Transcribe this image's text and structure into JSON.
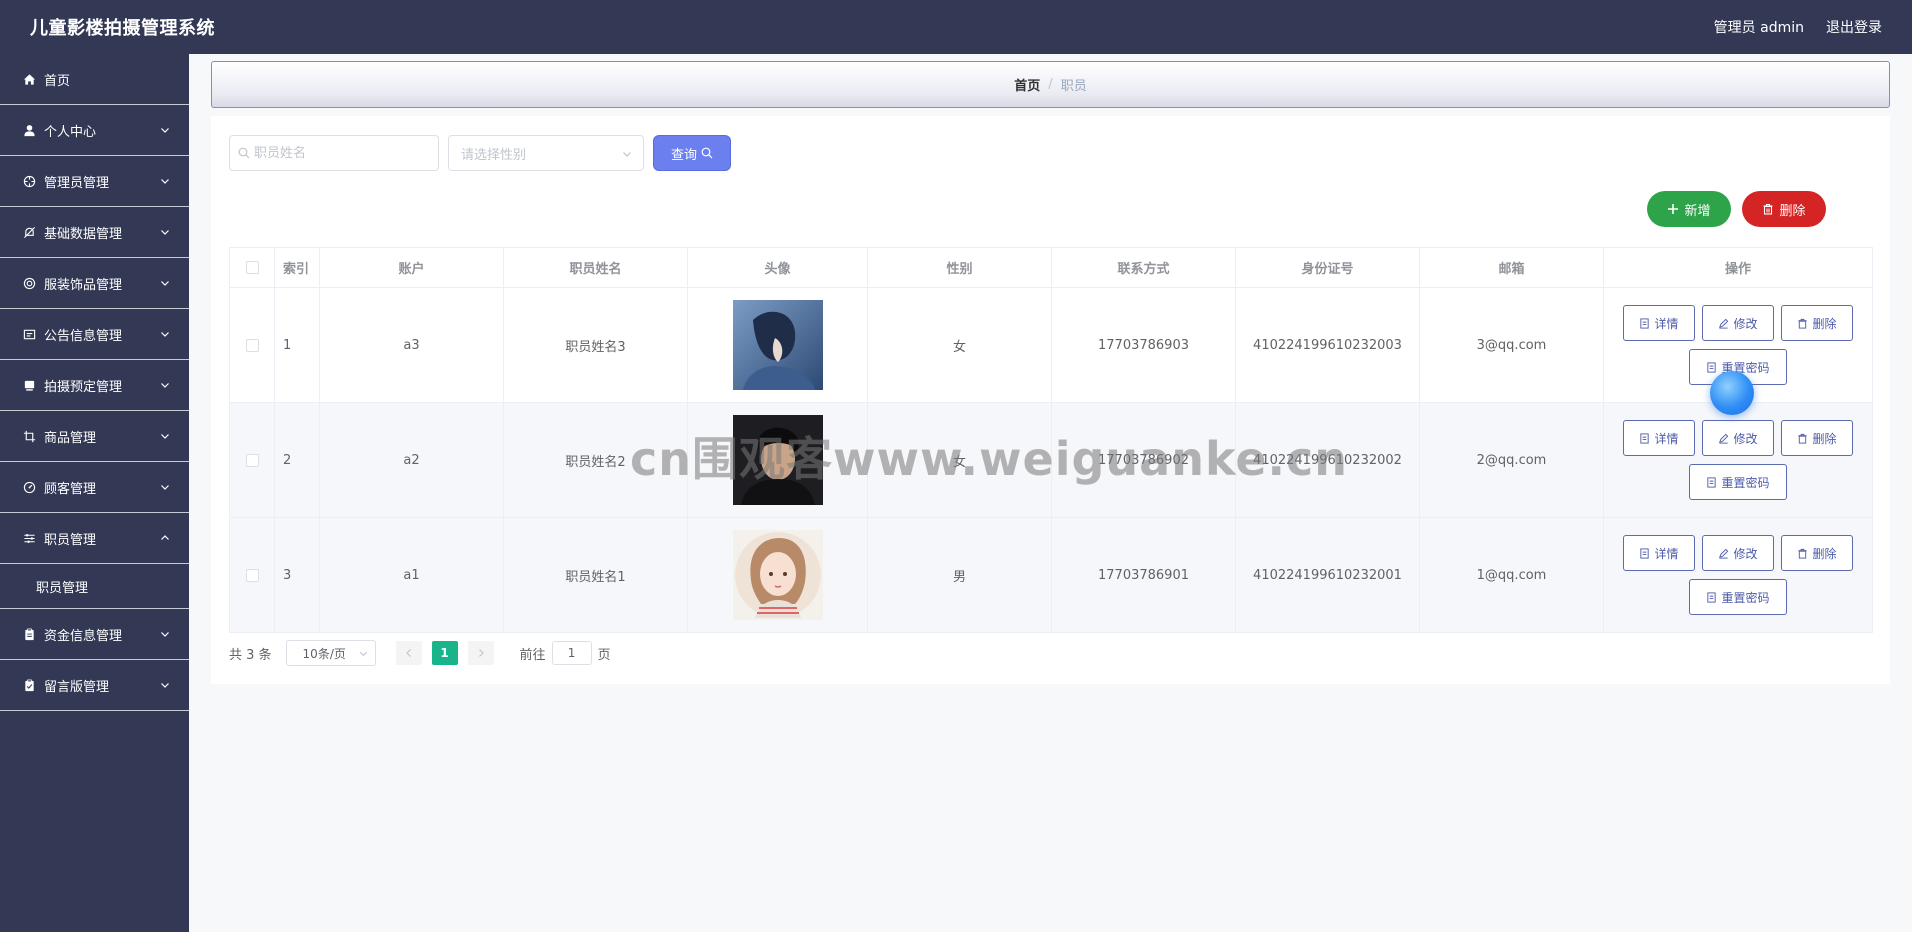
{
  "app": {
    "title": "儿童影楼拍摄管理系统",
    "user_label": "管理员 admin",
    "logout_label": "退出登录"
  },
  "sidebar": {
    "items": [
      {
        "label": "首页",
        "icon": "home-icon"
      },
      {
        "label": "个人中心",
        "icon": "user-icon"
      },
      {
        "label": "管理员管理",
        "icon": "crosshair-icon"
      },
      {
        "label": "基础数据管理",
        "icon": "bell-off-icon"
      },
      {
        "label": "服装饰品管理",
        "icon": "target-icon"
      },
      {
        "label": "公告信息管理",
        "icon": "notice-icon"
      },
      {
        "label": "拍摄预定管理",
        "icon": "camera-icon"
      },
      {
        "label": "商品管理",
        "icon": "crop-icon"
      },
      {
        "label": "顾客管理",
        "icon": "gauge-icon"
      },
      {
        "label": "职员管理",
        "icon": "sliders-icon",
        "expanded": true,
        "children": [
          {
            "label": "职员管理"
          }
        ]
      },
      {
        "label": "资金信息管理",
        "icon": "clipboard-icon"
      },
      {
        "label": "留言版管理",
        "icon": "clipboard-check-icon"
      }
    ]
  },
  "breadcrumb": {
    "home": "首页",
    "separator": "/",
    "current": "职员"
  },
  "search": {
    "name_placeholder": "职员姓名",
    "gender_placeholder": "请选择性别",
    "query_label": "查询"
  },
  "actions": {
    "add_label": "新增",
    "delete_label": "删除"
  },
  "table": {
    "headers": [
      "索引",
      "账户",
      "职员姓名",
      "头像",
      "性别",
      "联系方式",
      "身份证号",
      "邮箱",
      "操作"
    ],
    "rows": [
      {
        "index": "1",
        "account": "a3",
        "name": "职员姓名3",
        "avatar": "avatar-boy-anime",
        "gender": "女",
        "phone": "17703786903",
        "idcard": "410224199610232003",
        "email": "3@qq.com"
      },
      {
        "index": "2",
        "account": "a2",
        "name": "职员姓名2",
        "avatar": "avatar-man-photo",
        "gender": "女",
        "phone": "17703786902",
        "idcard": "410224199610232002",
        "email": "2@qq.com"
      },
      {
        "index": "3",
        "account": "a1",
        "name": "职员姓名1",
        "avatar": "avatar-girl-anime",
        "gender": "男",
        "phone": "17703786901",
        "idcard": "410224199610232001",
        "email": "1@qq.com"
      }
    ],
    "op_labels": {
      "detail": "详情",
      "edit": "修改",
      "delete": "删除",
      "reset_password": "重置密码"
    }
  },
  "pagination": {
    "total_text": "共 3 条",
    "page_size": "10条/页",
    "current_page": "1",
    "goto_prefix": "前往",
    "goto_value": "1",
    "goto_suffix": "页"
  },
  "watermark": "cn围观客www.weiguanke.cn",
  "colors": {
    "sidebar": "#333955",
    "primary": "#6b7fee",
    "success": "#2ea44a",
    "danger": "#d42424",
    "page_active": "#19b58a"
  }
}
